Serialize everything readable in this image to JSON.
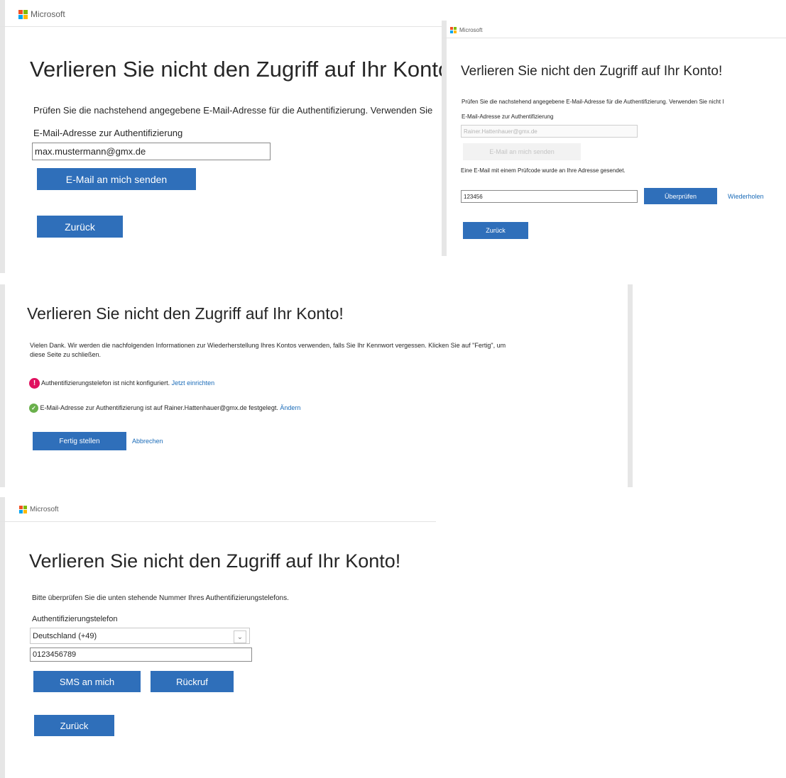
{
  "brand": {
    "name": "Microsoft",
    "colors": [
      "#f25022",
      "#7fba00",
      "#00a4ef",
      "#ffb900"
    ]
  },
  "accent": "#2f6fba",
  "panel1": {
    "title": "Verlieren Sie nicht den Zugriff auf Ihr Konto!",
    "description": "Prüfen Sie die nachstehend angegebene E-Mail-Adresse für die Authentifizierung. Verwenden Sie",
    "email_label": "E-Mail-Adresse zur Authentifizierung",
    "email_value": "max.mustermann@gmx.de",
    "send_button": "E-Mail an mich senden",
    "back_button": "Zurück"
  },
  "panel2": {
    "title": "Verlieren Sie nicht den Zugriff auf Ihr Konto!",
    "description": "Prüfen Sie die nachstehend angegebene E-Mail-Adresse für die Authentifizierung. Verwenden Sie nicht I",
    "email_label": "E-Mail-Adresse zur Authentifizierung",
    "email_value": "Rainer.Hattenhauer@gmx.de",
    "send_button": "E-Mail an mich senden",
    "sent_message": "Eine E-Mail mit einem Prüfcode wurde an Ihre Adresse gesendet.",
    "code_value": "123456",
    "verify_button": "Überprüfen",
    "retry_link": "Wiederholen",
    "back_button": "Zurück"
  },
  "panel3": {
    "title": "Verlieren Sie nicht den Zugriff auf Ihr Konto!",
    "description_line1": "Vielen Dank. Wir werden die nachfolgenden Informationen zur Wiederherstellung Ihres Kontos verwenden, falls Sie Ihr Kennwort vergessen. Klicken Sie auf \"Fertig\", um",
    "description_line2": "diese Seite zu schließen.",
    "phone_status_text": "Authentifizierungstelefon ist nicht konfiguriert.",
    "phone_status_link": "Jetzt einrichten",
    "email_status_text": "E-Mail-Adresse zur Authentifizierung ist auf Rainer.Hattenhauer@gmx.de festgelegt.",
    "email_status_link": "Ändern",
    "finish_button": "Fertig stellen",
    "cancel_link": "Abbrechen",
    "error_icon_glyph": "!",
    "success_icon_glyph": "✓"
  },
  "panel4": {
    "title": "Verlieren Sie nicht den Zugriff auf Ihr Konto!",
    "description": "Bitte überprüfen Sie die unten stehende Nummer Ihres Authentifizierungstelefons.",
    "phone_label": "Authentifizierungstelefon",
    "country_selected": "Deutschland (+49)",
    "phone_value": "0123456789",
    "sms_button": "SMS an mich",
    "callback_button": "Rückruf",
    "back_button": "Zurück"
  }
}
